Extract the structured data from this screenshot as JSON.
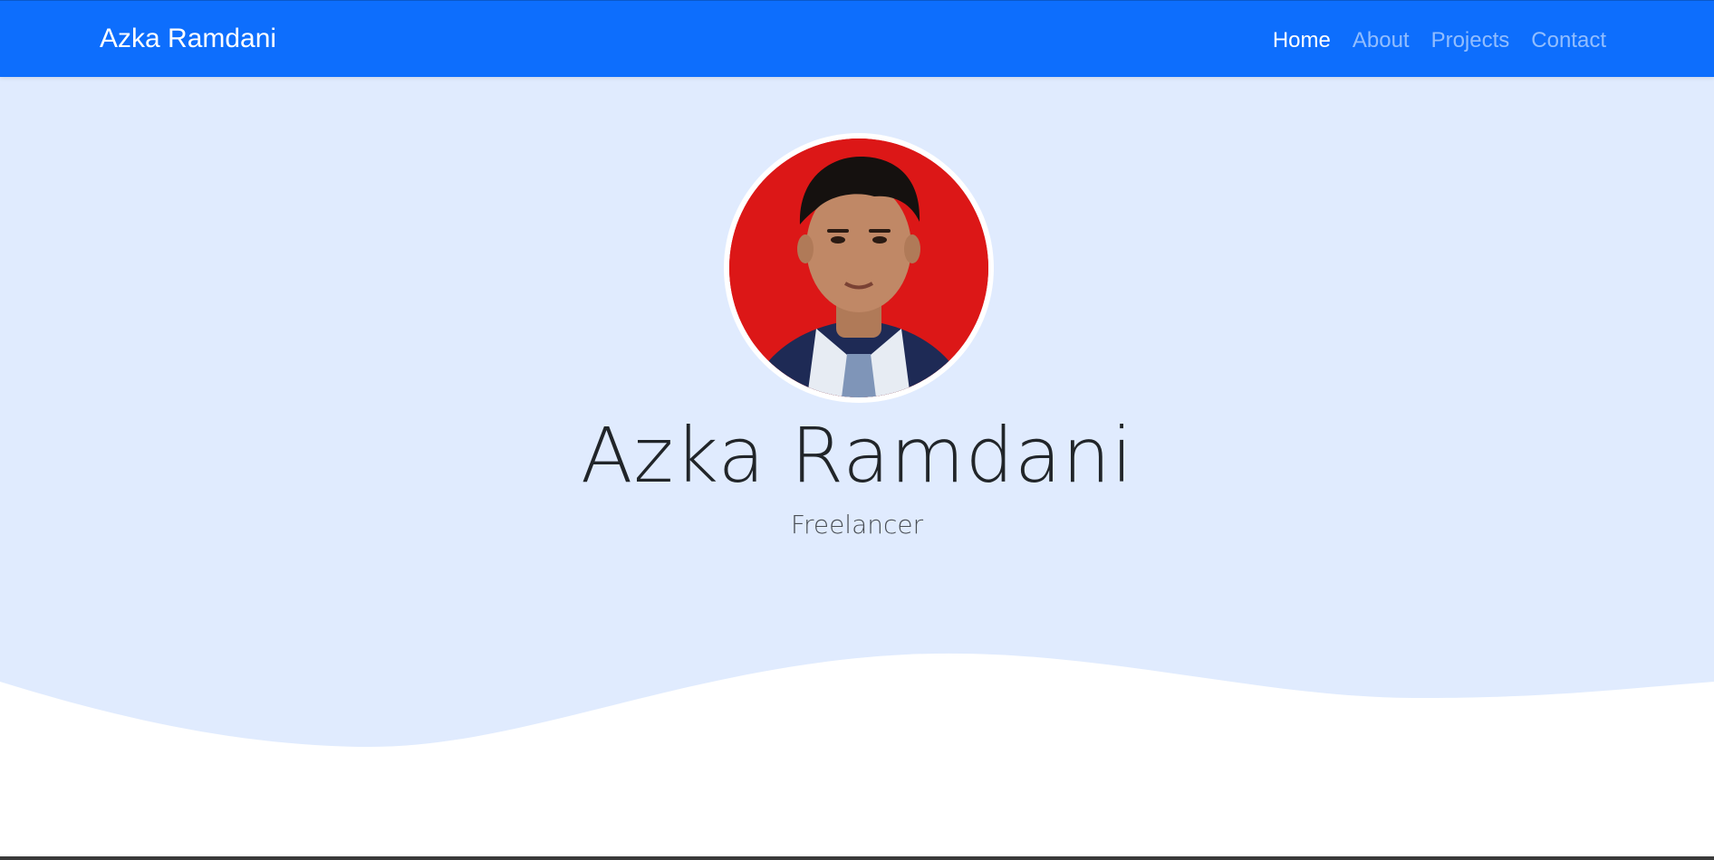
{
  "navbar": {
    "brand": "Azka Ramdani",
    "links": [
      {
        "label": "Home",
        "active": true
      },
      {
        "label": "About",
        "active": false
      },
      {
        "label": "Projects",
        "active": false
      },
      {
        "label": "Contact",
        "active": false
      }
    ]
  },
  "hero": {
    "name": "Azka Ramdani",
    "role": "Freelancer",
    "avatar_icon": "profile-photo"
  },
  "colors": {
    "navbar_bg": "#0d6efd",
    "hero_bg": "#e0ebfe",
    "wave_fill": "#ffffff",
    "avatar_bg": "#dc1717"
  }
}
